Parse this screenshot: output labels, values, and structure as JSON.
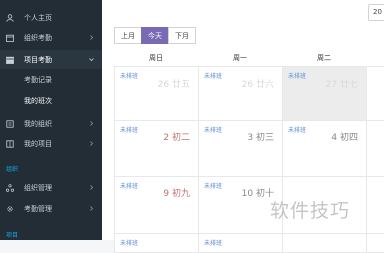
{
  "sidebar": {
    "items": [
      {
        "label": "个人主页",
        "icon": "user-icon"
      },
      {
        "label": "组织考勤",
        "icon": "calendar-icon"
      },
      {
        "label": "项目考勤",
        "icon": "calendar-icon"
      },
      {
        "label": "考勤记录"
      },
      {
        "label": "我的班次"
      },
      {
        "label": "我的组织",
        "icon": "org-icon"
      },
      {
        "label": "我的项目",
        "icon": "project-icon"
      },
      {
        "label": "组织管理",
        "icon": "org-manage-icon"
      },
      {
        "label": "考勤管理",
        "icon": "gear-icon"
      }
    ],
    "sections": [
      "组织",
      "项目"
    ]
  },
  "toolbar": {
    "prev": "上月",
    "today": "今天",
    "next": "下月",
    "date_value": "20"
  },
  "calendar": {
    "headers": [
      "周日",
      "周一",
      "周二"
    ],
    "rows": [
      [
        {
          "tag": "未排班",
          "day": "26 廿五"
        },
        {
          "tag": "未排班",
          "day": "26 廿六"
        },
        {
          "tag": "未排班",
          "day": "27 廿七"
        }
      ],
      [
        {
          "tag": "未排班",
          "day": "2 初二"
        },
        {
          "tag": "未排班",
          "day": "3 初三"
        },
        {
          "tag": "未排班",
          "day": "4 初四"
        }
      ],
      [
        {
          "tag": "未排班",
          "day": "9 初九"
        },
        {
          "tag": "未排班",
          "day": "10 初十"
        },
        {
          "tag": "",
          "day": ""
        }
      ],
      [
        {
          "tag": "未排班",
          "day": ""
        },
        {
          "tag": "未排班",
          "day": ""
        },
        {
          "tag": "",
          "day": ""
        }
      ]
    ]
  },
  "watermark": "软件技巧"
}
